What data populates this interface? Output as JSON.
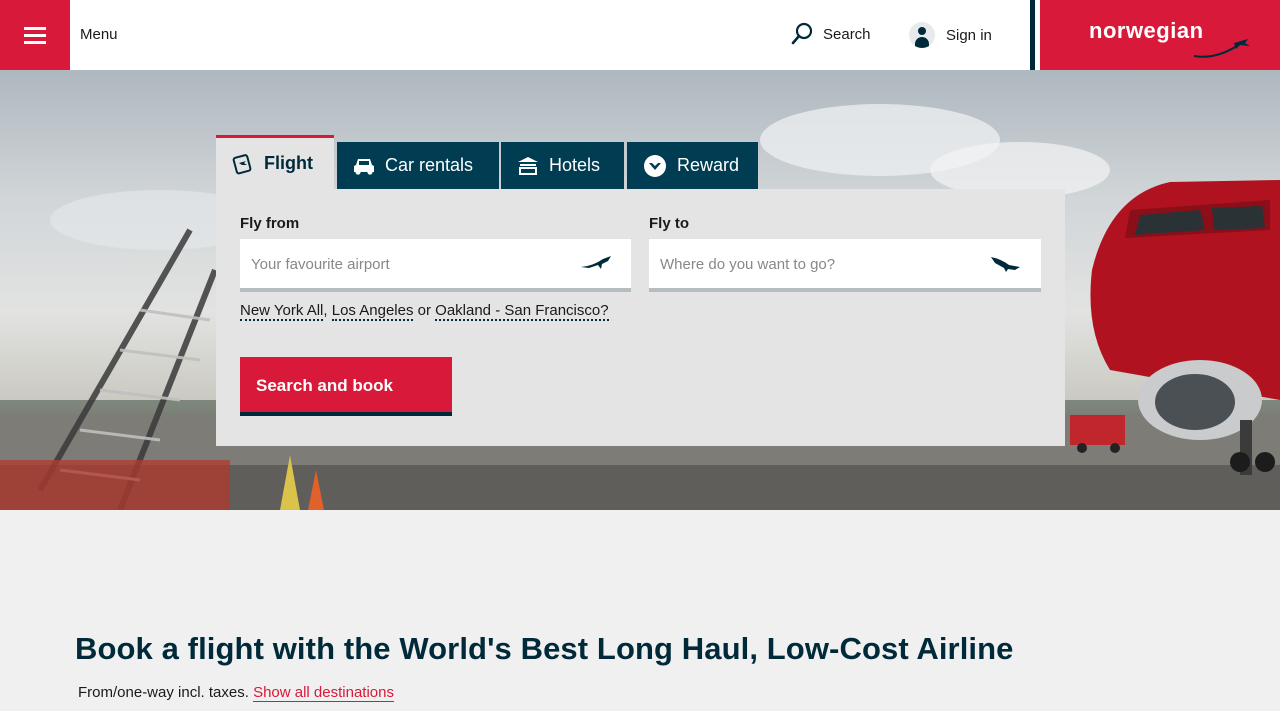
{
  "header": {
    "menu_label": "Menu",
    "search_label": "Search",
    "signin_label": "Sign in",
    "brand_name": "norwegian",
    "brand_color": "#d81939",
    "dark_color": "#002a3a"
  },
  "booking": {
    "tabs": [
      {
        "label": "Flight",
        "icon": "flight-ticket-icon",
        "active": true
      },
      {
        "label": "Car rentals",
        "icon": "car-icon",
        "active": false
      },
      {
        "label": "Hotels",
        "icon": "hotel-icon",
        "active": false
      },
      {
        "label": "Reward",
        "icon": "reward-icon",
        "active": false
      }
    ],
    "from_label": "Fly from",
    "from_placeholder": "Your favourite airport",
    "to_label": "Fly to",
    "to_placeholder": "Where do you want to go?",
    "quick_links": [
      "New York All",
      "Los Angeles",
      "Oakland - San Francisco?"
    ],
    "quick_sep_1": ",",
    "quick_sep_2": "or",
    "search_button": "Search and book"
  },
  "main": {
    "headline": "Book a flight with the World's Best Long Haul, Low-Cost Airline",
    "subline_text": "From/one-way incl. taxes.",
    "show_all_link": "Show all destinations"
  }
}
